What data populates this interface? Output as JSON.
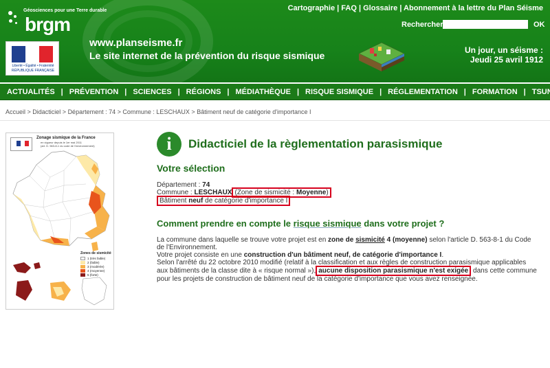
{
  "header": {
    "brgm_tagline": "Géosciences pour une Terre durable",
    "brgm_logo": "brgm",
    "rf_line1": "Liberté • Égalité • Fraternité",
    "rf_line2": "RÉPUBLIQUE FRANÇAISE",
    "site_url": "www.planseisme.fr",
    "site_subtitle": "Le site internet de la prévention du risque sismique",
    "top_links": [
      "Cartographie",
      "FAQ",
      "Glossaire",
      "Abonnement à la lettre du Plan Séisme"
    ],
    "search_label": "Rechercher",
    "search_value": "",
    "search_button": "OK",
    "date_line1": "Un jour, un séisme :",
    "date_line2": "Jeudi 25 avril 1912"
  },
  "nav": [
    "ACTUALITÉS",
    "PRÉVENTION",
    "SCIENCES",
    "RÉGIONS",
    "MÉDIATHÈQUE",
    "RISQUE SISMIQUE",
    "RÉGLEMENTATION",
    "FORMATION",
    "TSUNAMIS"
  ],
  "breadcrumb": {
    "items": [
      "Accueil",
      "Didacticiel",
      "Département : 74",
      "Commune : LESCHAUX",
      "Bâtiment neuf de catégorie d'importance I"
    ],
    "separator": " > "
  },
  "map": {
    "title": "Zonage sismique de la France",
    "sub1": "en vigueur depuis le 1er mai 2011",
    "sub2": "(art. D. 563-8-1 du code de l'environnement)",
    "legend_title": "Zones de sismicité",
    "legend": [
      {
        "label": "1 (très faible)",
        "color": "#ffffff"
      },
      {
        "label": "2 (faible)",
        "color": "#fde9a8"
      },
      {
        "label": "3 (modérée)",
        "color": "#f7b24a"
      },
      {
        "label": "4 (moyenne)",
        "color": "#e8541c"
      },
      {
        "label": "5 (forte)",
        "color": "#8b1a1a"
      }
    ]
  },
  "content": {
    "title": "Didacticiel de la règlementation parasismique",
    "selection_heading": "Votre sélection",
    "dept_label": "Département : ",
    "dept_value": "74",
    "commune_label": "Commune : ",
    "commune_value": "LESCHAUX",
    "zone_prefix": "Zone de sismicité : ",
    "zone_value": "Moyenne",
    "zone_suffix": ")",
    "zone_open": "(",
    "batiment_prefix": "Bâtiment ",
    "batiment_bold": "neuf",
    "batiment_suffix": " de catégorie d'importance I",
    "question_pre": "Comment prendre en compte le ",
    "question_link": "risque sismique",
    "question_post": " dans votre projet ?",
    "p1_a": "La commune dans laquelle se trouve votre projet est en ",
    "p1_b": "zone de ",
    "p1_c": "sismicité",
    "p1_d": " 4 (moyenne)",
    "p1_e": " selon l'article D. 563-8-1 du Code",
    "p2": "de l'Environnement.",
    "p3_a": "Votre projet consiste en une ",
    "p3_b": "construction d'un bâtiment neuf, de catégorie d'importance I",
    "p3_c": ".",
    "p4": "Selon l'arrêté du 22 octobre 2010 modifié (relatif à la classification et aux règles de construction parasismique applicables",
    "p5_a": "aux bâtiments de la classe dite à « risque normal »),",
    "p5_b": "aucune disposition parasismique n'est exigée",
    "p5_c": " dans cette commune",
    "p6": "pour les projets de construction de bâtiment neuf de la catégorie d'importance que vous avez renseignée."
  },
  "colors": {
    "header_green": "#1d8a1a",
    "nav_green": "#1b7a18",
    "heading_green": "#1f6e1c",
    "highlight_red": "#d6001c"
  }
}
